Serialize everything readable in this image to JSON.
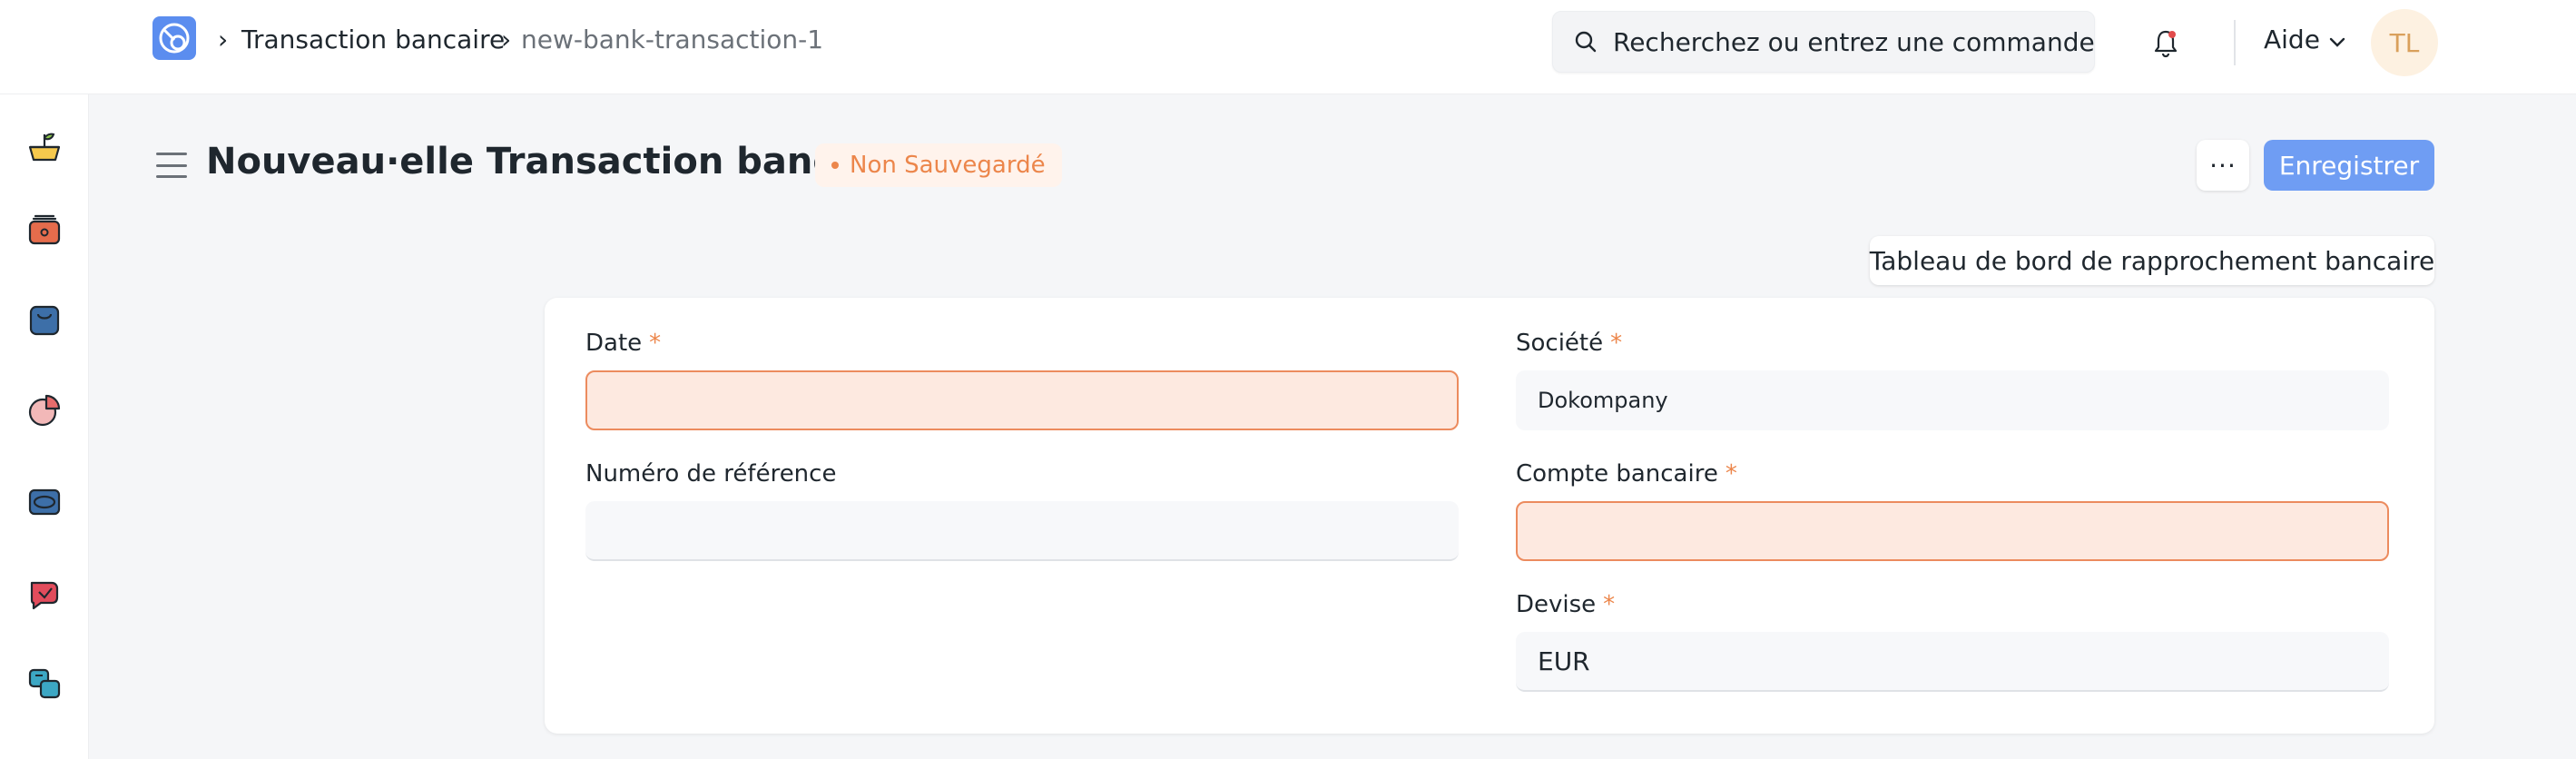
{
  "breadcrumb": {
    "items": [
      "Transaction bancaire",
      "new-bank-transaction-1"
    ]
  },
  "search": {
    "placeholder": "Recherchez ou entrez une commande"
  },
  "header": {
    "help_label": "Aide",
    "avatar_initials": "TL"
  },
  "sidebar": {
    "icons": [
      "accounting-icon",
      "buying-icon",
      "selling-icon",
      "analytics-icon",
      "assets-icon",
      "support-icon",
      "integrations-icon"
    ]
  },
  "page": {
    "title": "Nouveau·elle Transaction bancaire",
    "status": "Non Sauvegardé",
    "more_label": "···",
    "save_label": "Enregistrer",
    "dashboard_label": "Tableau de bord de rapprochement bancaire"
  },
  "form": {
    "date": {
      "label": "Date",
      "value": "",
      "required": true
    },
    "reference": {
      "label": "Numéro de référence",
      "value": ""
    },
    "company": {
      "label": "Société",
      "value": "Dokompany",
      "required": true
    },
    "bank_account": {
      "label": "Compte bancaire",
      "value": "",
      "required": true
    },
    "currency": {
      "label": "Devise",
      "value": "EUR",
      "required": true
    },
    "required_mark": "*"
  },
  "colors": {
    "primary": "#6f9df3",
    "warning": "#ec864b",
    "error_fill": "#fde9e0"
  }
}
